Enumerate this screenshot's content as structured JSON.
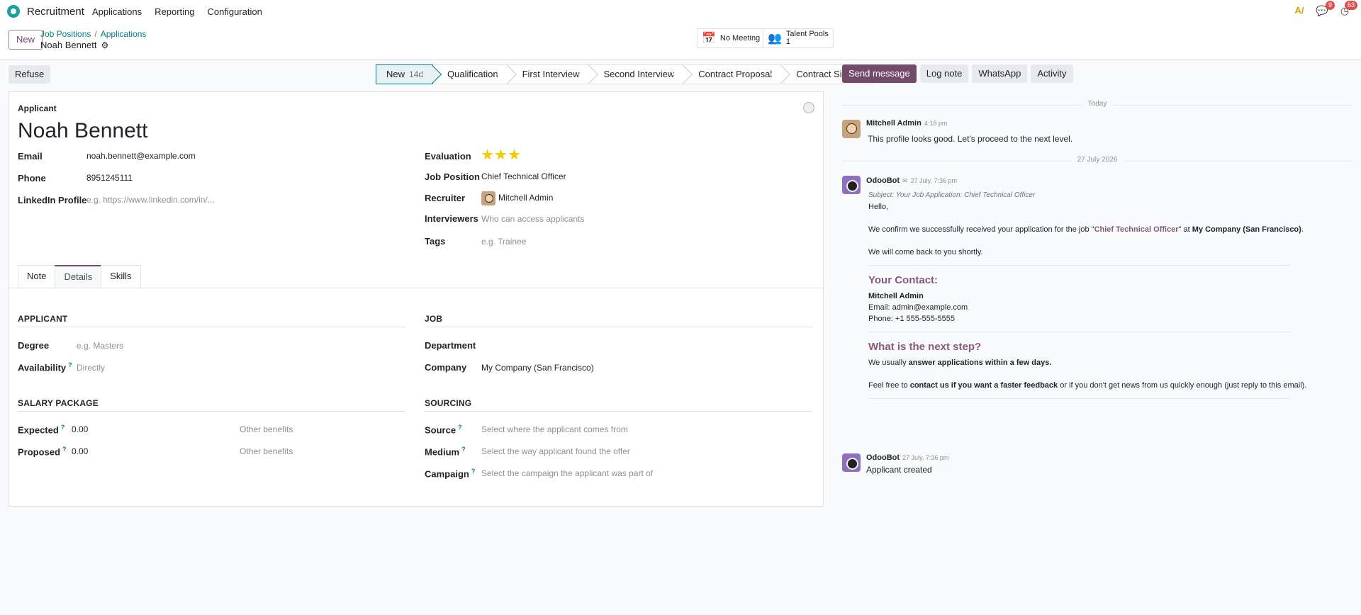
{
  "nav": {
    "app_name": "Recruitment",
    "menu": [
      "Applications",
      "Reporting",
      "Configuration"
    ],
    "badges": {
      "messages": "9",
      "activities": "63"
    }
  },
  "cp": {
    "new_label": "New",
    "breadcrumb": [
      "Job Positions",
      "Applications"
    ],
    "record_name": "Noah Bennett",
    "smart": [
      {
        "label": "No Meeting",
        "count": ""
      },
      {
        "label": "Talent Pools",
        "count": "1"
      }
    ]
  },
  "actions": {
    "refuse": "Refuse"
  },
  "stages": [
    {
      "label": "New",
      "days": "14d"
    },
    {
      "label": "Qualification"
    },
    {
      "label": "First Interview"
    },
    {
      "label": "Second Interview"
    },
    {
      "label": "Contract Proposal"
    },
    {
      "label": "Contract Signed"
    }
  ],
  "form": {
    "title_label": "Applicant",
    "name": "Noah Bennett",
    "email_label": "Email",
    "email": "noah.bennett@example.com",
    "phone_label": "Phone",
    "phone": "8951245111",
    "linkedin_label": "LinkedIn Profile",
    "linkedin_ph": "e.g. https://www.linkedin.com/in/...",
    "evaluation_label": "Evaluation",
    "evaluation": 3,
    "evaluation_max": 3,
    "job_label": "Job Position",
    "job": "Chief Technical Officer",
    "recruiter_label": "Recruiter",
    "recruiter": "Mitchell Admin",
    "interviewers_label": "Interviewers",
    "interviewers_ph": "Who can access applicants",
    "tags_label": "Tags",
    "tags_ph": "e.g. Trainee",
    "tabs": [
      "Note",
      "Details",
      "Skills"
    ],
    "sec_applicant": "APPLICANT",
    "degree_label": "Degree",
    "degree_ph": "e.g. Masters",
    "availability_label": "Availability",
    "availability_ph": "Directly",
    "sec_job": "JOB",
    "department_label": "Department",
    "company_label": "Company",
    "company": "My Company (San Francisco)",
    "sec_salary": "SALARY PACKAGE",
    "expected_label": "Expected",
    "expected": "0.00",
    "proposed_label": "Proposed",
    "proposed": "0.00",
    "other_benefits": "Other benefits",
    "sec_sourcing": "SOURCING",
    "source_label": "Source",
    "source_ph": "Select where the applicant comes from",
    "medium_label": "Medium",
    "medium_ph": "Select the way applicant found the offer",
    "campaign_label": "Campaign",
    "campaign_ph": "Select the campaign the applicant was part of",
    "help": "?"
  },
  "chatter": {
    "buttons": [
      "Send message",
      "Log note",
      "WhatsApp",
      "Activity"
    ],
    "today": "Today",
    "date2": "27 July 2026",
    "m1": {
      "author": "Mitchell Admin",
      "time": "4:18 pm",
      "text": "This profile looks good. Let's proceed to the next level."
    },
    "m2": {
      "author": "OdooBot",
      "time": "27 July, 7:36 pm",
      "subject": "Subject: Your Job Application: Chief Technical Officer",
      "hello": "Hello,",
      "p1a": "We confirm we successfully received your application for the job \"",
      "p1job": "Chief Technical Officer",
      "p1b": "\" at ",
      "p1co": "My Company (San Francisco)",
      "p1c": ".",
      "p2": "We will come back to you shortly.",
      "contact_h": "Your Contact:",
      "contact_name": "Mitchell Admin",
      "contact_email": "Email: admin@example.com",
      "contact_phone": "Phone: +1 555-555-5555",
      "next_h": "What is the next step?",
      "p3a": "We usually ",
      "p3b": "answer applications within a few days.",
      "p4a": "Feel free to ",
      "p4b": "contact us if you want a faster feedback",
      "p4c": " or if you don't get news from us quickly enough (just reply to this email)."
    },
    "m3": {
      "author": "OdooBot",
      "time": "27 July, 7:36 pm",
      "text": "Applicant created"
    }
  }
}
